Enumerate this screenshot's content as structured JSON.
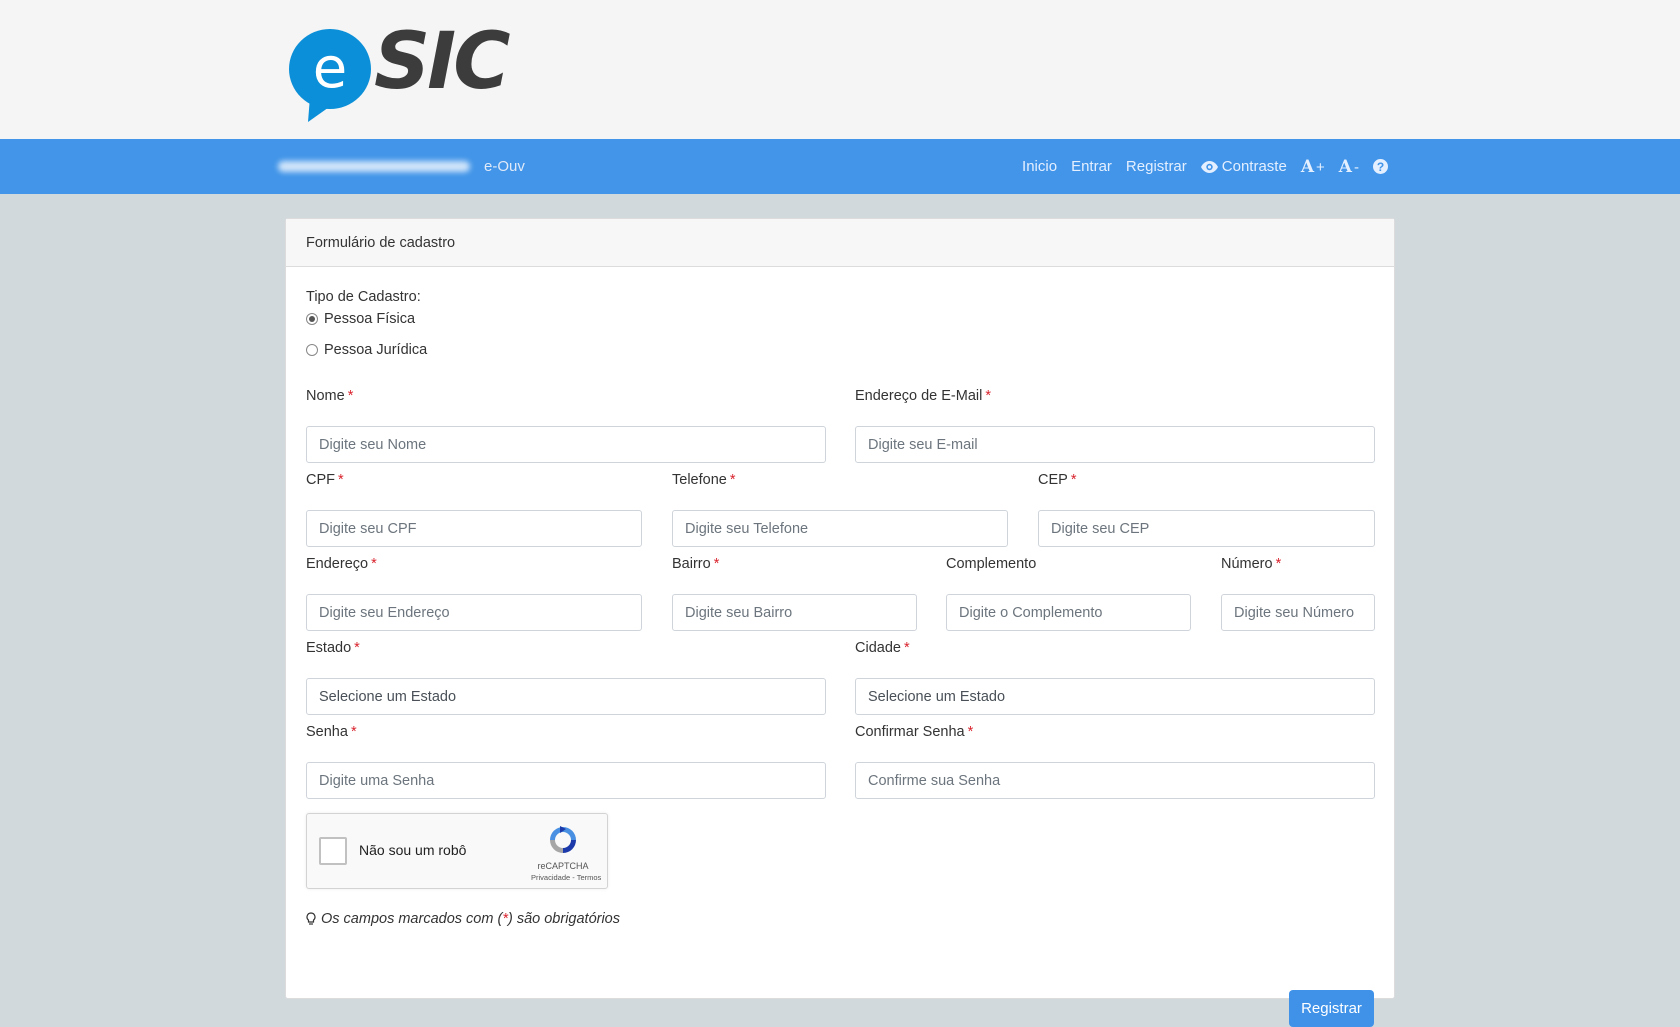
{
  "header": {
    "logo_letter": "e",
    "logo_text": "SIC",
    "brand_color": "#0a8fd8"
  },
  "navbar": {
    "brand": "e-Ouv",
    "links": {
      "inicio": "Inicio",
      "entrar": "Entrar",
      "registrar": "Registrar",
      "contraste": "Contraste",
      "font_increase": "A",
      "font_increase_sign": "+",
      "font_decrease": "A",
      "font_decrease_sign": "-"
    },
    "color": "#4295e9"
  },
  "form": {
    "title": "Formulário de cadastro",
    "tipo_label": "Tipo de Cadastro:",
    "tipo_options": [
      "Pessoa Física",
      "Pessoa Jurídica"
    ],
    "tipo_selected": "Pessoa Física",
    "required_mark": "*",
    "fields": {
      "nome": {
        "label": "Nome",
        "placeholder": "Digite seu Nome"
      },
      "email": {
        "label": "Endereço de E-Mail",
        "placeholder": "Digite seu E-mail"
      },
      "cpf": {
        "label": "CPF",
        "placeholder": "Digite seu CPF"
      },
      "telefone": {
        "label": "Telefone",
        "placeholder": "Digite seu Telefone"
      },
      "cep": {
        "label": "CEP",
        "placeholder": "Digite seu CEP"
      },
      "endereco": {
        "label": "Endereço",
        "placeholder": "Digite seu Endereço"
      },
      "bairro": {
        "label": "Bairro",
        "placeholder": "Digite seu Bairro"
      },
      "complemento": {
        "label": "Complemento",
        "placeholder": "Digite o Complemento"
      },
      "numero": {
        "label": "Número",
        "placeholder": "Digite seu Número"
      },
      "estado": {
        "label": "Estado",
        "value": "Selecione um Estado"
      },
      "cidade": {
        "label": "Cidade",
        "value": "Selecione um Estado"
      },
      "senha": {
        "label": "Senha",
        "placeholder": "Digite uma Senha"
      },
      "confirmar_senha": {
        "label": "Confirmar Senha",
        "placeholder": "Confirme sua Senha"
      }
    },
    "captcha": {
      "text": "Não sou um robô",
      "brand": "reCAPTCHA",
      "links": "Privacidade - Termos"
    },
    "note_before": "Os campos marcados com (",
    "note_star": "*",
    "note_after": ") são obrigatórios",
    "submit": "Registrar",
    "submit_color": "#3f92e8"
  }
}
